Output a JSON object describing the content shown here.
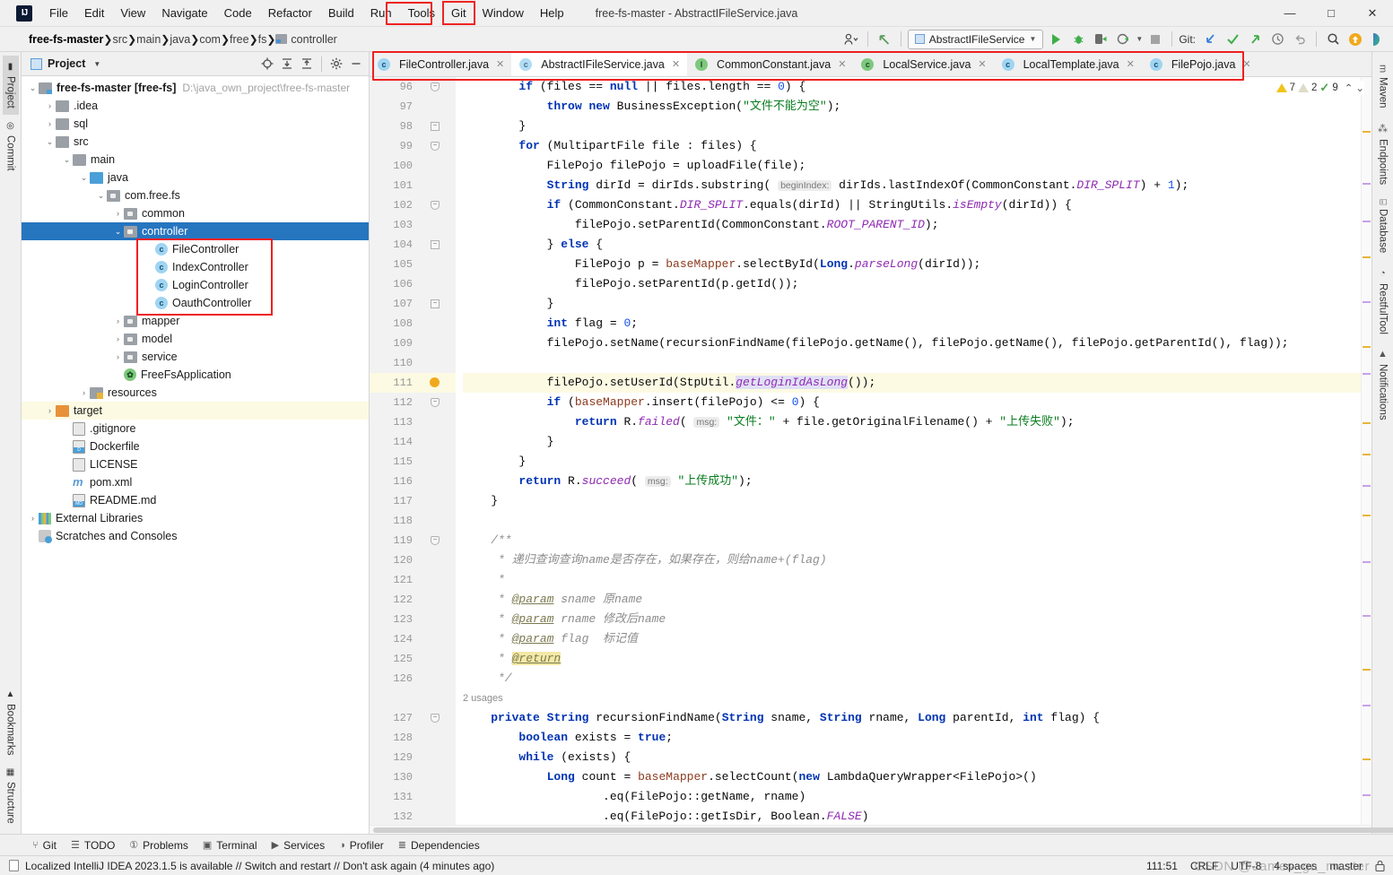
{
  "window": {
    "title": "free-fs-master - AbstractIFileService.java",
    "controls": {
      "minimize": "—",
      "maximize": "□",
      "close": "✕"
    }
  },
  "menubar": {
    "logo": "IJ",
    "items": [
      {
        "label": "File",
        "highlighted": false
      },
      {
        "label": "Edit",
        "highlighted": false
      },
      {
        "label": "View",
        "highlighted": false
      },
      {
        "label": "Navigate",
        "highlighted": false
      },
      {
        "label": "Code",
        "highlighted": false
      },
      {
        "label": "Refactor",
        "highlighted": false
      },
      {
        "label": "Build",
        "highlighted": false
      },
      {
        "label": "Run",
        "highlighted": false
      },
      {
        "label": "Tools",
        "highlighted": false
      },
      {
        "label": "Git",
        "highlighted": true
      },
      {
        "label": "Window",
        "highlighted": false
      },
      {
        "label": "Help",
        "highlighted": false
      }
    ]
  },
  "breadcrumb": {
    "items": [
      "free-fs-master",
      "src",
      "main",
      "java",
      "com",
      "free",
      "fs",
      "controller"
    ]
  },
  "navbar_right": {
    "run_config": "AbstractIFileService",
    "git_label": "Git:",
    "icons": [
      "user-settings-icon",
      "back-arrow-icon",
      "run-icon",
      "debug-icon",
      "run-with-coverage-icon",
      "profile-icon",
      "stop-icon",
      "git-update-icon",
      "git-commit-icon",
      "git-push-icon",
      "git-history-icon",
      "git-rollback-icon",
      "search-everywhere-icon",
      "update-app-icon",
      "ide-assistant-icon"
    ]
  },
  "left_rail": {
    "top": [
      {
        "label": "Project",
        "icon": "project-icon",
        "active": true
      },
      {
        "label": "Commit",
        "icon": "commit-icon",
        "active": false
      }
    ],
    "bottom": [
      {
        "label": "Bookmarks",
        "icon": "bookmark-icon"
      },
      {
        "label": "Structure",
        "icon": "structure-icon"
      }
    ]
  },
  "right_rail": {
    "items": [
      {
        "label": "Maven",
        "icon": "maven-icon"
      },
      {
        "label": "Endpoints",
        "icon": "endpoints-icon"
      },
      {
        "label": "Database",
        "icon": "database-icon"
      },
      {
        "label": "RestfulTool",
        "icon": "restful-tool-icon"
      },
      {
        "label": "Notifications",
        "icon": "notifications-icon"
      }
    ]
  },
  "project_panel": {
    "title": "Project",
    "toolbar_icons": [
      "locate-icon",
      "expand-all-icon",
      "collapse-all-icon",
      "settings-gear-icon",
      "hide-icon"
    ],
    "tree": [
      {
        "indent": 0,
        "arrow": "⌄",
        "icon": "module-folder",
        "label": "free-fs-master [free-fs]",
        "path": "D:\\java_own_project\\free-fs-master",
        "bold_part": "[free-fs]"
      },
      {
        "indent": 1,
        "arrow": "›",
        "icon": "folder-grey",
        "label": ".idea"
      },
      {
        "indent": 1,
        "arrow": "›",
        "icon": "folder-grey",
        "label": "sql"
      },
      {
        "indent": 1,
        "arrow": "⌄",
        "icon": "folder-grey",
        "label": "src"
      },
      {
        "indent": 2,
        "arrow": "⌄",
        "icon": "folder-grey",
        "label": "main"
      },
      {
        "indent": 3,
        "arrow": "⌄",
        "icon": "folder-source",
        "label": "java"
      },
      {
        "indent": 4,
        "arrow": "⌄",
        "icon": "package",
        "label": "com.free.fs"
      },
      {
        "indent": 5,
        "arrow": "›",
        "icon": "package",
        "label": "common"
      },
      {
        "indent": 5,
        "arrow": "⌄",
        "icon": "package",
        "label": "controller",
        "selected": true
      },
      {
        "indent": 6,
        "arrow": "",
        "icon": "java-class",
        "label": "FileController",
        "boxed": true
      },
      {
        "indent": 6,
        "arrow": "",
        "icon": "java-class",
        "label": "IndexController",
        "boxed": true
      },
      {
        "indent": 6,
        "arrow": "",
        "icon": "java-class",
        "label": "LoginController",
        "boxed": true
      },
      {
        "indent": 6,
        "arrow": "",
        "icon": "java-class",
        "label": "OauthController",
        "boxed": true
      },
      {
        "indent": 5,
        "arrow": "›",
        "icon": "package",
        "label": "mapper"
      },
      {
        "indent": 5,
        "arrow": "›",
        "icon": "package",
        "label": "model"
      },
      {
        "indent": 5,
        "arrow": "›",
        "icon": "package",
        "label": "service"
      },
      {
        "indent": 5,
        "arrow": "",
        "icon": "spring-class",
        "label": "FreeFsApplication"
      },
      {
        "indent": 3,
        "arrow": "›",
        "icon": "folder-resources",
        "label": "resources"
      },
      {
        "indent": 1,
        "arrow": "›",
        "icon": "folder-target",
        "label": "target",
        "highlight": true
      },
      {
        "indent": 2,
        "arrow": "",
        "icon": "file-gitignore",
        "label": ".gitignore"
      },
      {
        "indent": 2,
        "arrow": "",
        "icon": "file-docker",
        "label": "Dockerfile"
      },
      {
        "indent": 2,
        "arrow": "",
        "icon": "file-text",
        "label": "LICENSE"
      },
      {
        "indent": 2,
        "arrow": "",
        "icon": "file-maven",
        "label": "pom.xml"
      },
      {
        "indent": 2,
        "arrow": "",
        "icon": "file-markdown",
        "label": "README.md"
      },
      {
        "indent": 0,
        "arrow": "›",
        "icon": "external-libraries",
        "label": "External Libraries"
      },
      {
        "indent": 0,
        "arrow": "",
        "icon": "scratches",
        "label": "Scratches and Consoles"
      }
    ]
  },
  "editor_tabs": [
    {
      "label": "FileController.java",
      "icon": "java-class",
      "active": false
    },
    {
      "label": "AbstractIFileService.java",
      "icon": "java-abstract-class",
      "active": true
    },
    {
      "label": "CommonConstant.java",
      "icon": "java-interface",
      "active": false
    },
    {
      "label": "LocalService.java",
      "icon": "spring-class",
      "active": false
    },
    {
      "label": "LocalTemplate.java",
      "icon": "java-class",
      "active": false
    },
    {
      "label": "FilePojo.java",
      "icon": "java-class",
      "active": false
    }
  ],
  "inspections": {
    "warnings": "7",
    "weak_warnings": "2",
    "checks": "9",
    "up_arrow": "⌃",
    "down_arrow": "⌄"
  },
  "code": {
    "first_line_number": 96,
    "highlighted_line": 111,
    "lines": [
      {
        "n": 96,
        "fold": "end",
        "raw": "        if (files == null || files.length == 0) {"
      },
      {
        "n": 97,
        "fold": "",
        "raw": "            throw new BusinessException(\"文件不能为空\");"
      },
      {
        "n": 98,
        "fold": "plain",
        "raw": "        }"
      },
      {
        "n": 99,
        "fold": "start",
        "raw": "        for (MultipartFile file : files) {"
      },
      {
        "n": 100,
        "fold": "",
        "raw": "            FilePojo filePojo = uploadFile(file);"
      },
      {
        "n": 101,
        "fold": "",
        "raw": "            String dirId = dirIds.substring( beginIndex: dirIds.lastIndexOf(CommonConstant.DIR_SPLIT) + 1);"
      },
      {
        "n": 102,
        "fold": "start",
        "raw": "            if (CommonConstant.DIR_SPLIT.equals(dirId) || StringUtils.isEmpty(dirId)) {"
      },
      {
        "n": 103,
        "fold": "",
        "raw": "                filePojo.setParentId(CommonConstant.ROOT_PARENT_ID);"
      },
      {
        "n": 104,
        "fold": "plain",
        "raw": "            } else {"
      },
      {
        "n": 105,
        "fold": "",
        "raw": "                FilePojo p = baseMapper.selectById(Long.parseLong(dirId));"
      },
      {
        "n": 106,
        "fold": "",
        "raw": "                filePojo.setParentId(p.getId());"
      },
      {
        "n": 107,
        "fold": "plain",
        "raw": "            }"
      },
      {
        "n": 108,
        "fold": "",
        "raw": "            int flag = 0;"
      },
      {
        "n": 109,
        "fold": "",
        "raw": "            filePojo.setName(recursionFindName(filePojo.getName(), filePojo.getName(), filePojo.getParentId(), flag));"
      },
      {
        "n": 110,
        "fold": "",
        "raw": ""
      },
      {
        "n": 111,
        "fold": "bulb",
        "raw": "            filePojo.setUserId(StpUtil.getLoginIdAsLong());"
      },
      {
        "n": 112,
        "fold": "start",
        "raw": "            if (baseMapper.insert(filePojo) <= 0) {"
      },
      {
        "n": 113,
        "fold": "",
        "raw": "                return R.failed( msg: \"文件：\" + file.getOriginalFilename() + \"上传失败\");"
      },
      {
        "n": 114,
        "fold": "",
        "raw": "            }"
      },
      {
        "n": 115,
        "fold": "",
        "raw": "        }"
      },
      {
        "n": 116,
        "fold": "",
        "raw": "        return R.succeed( msg: \"上传成功\");"
      },
      {
        "n": 117,
        "fold": "",
        "raw": "    }"
      },
      {
        "n": 118,
        "fold": "",
        "raw": ""
      },
      {
        "n": 119,
        "fold": "start",
        "raw": "    /**"
      },
      {
        "n": 120,
        "fold": "",
        "raw": "     * 递归查询查询name是否存在，如果存在，则给name+(flag)"
      },
      {
        "n": 121,
        "fold": "",
        "raw": "     *"
      },
      {
        "n": 122,
        "fold": "",
        "raw": "     * @param sname 原name"
      },
      {
        "n": 123,
        "fold": "",
        "raw": "     * @param rname 修改后name"
      },
      {
        "n": 124,
        "fold": "",
        "raw": "     * @param flag  标记值"
      },
      {
        "n": 125,
        "fold": "",
        "raw": "     * @return"
      },
      {
        "n": 126,
        "fold": "",
        "raw": "     */"
      },
      {
        "n": 127,
        "fold": "start",
        "raw": "    private String recursionFindName(String sname, String rname, Long parentId, int flag) {",
        "usages": "2 usages"
      },
      {
        "n": 128,
        "fold": "",
        "raw": "        boolean exists = true;"
      },
      {
        "n": 129,
        "fold": "",
        "raw": "        while (exists) {"
      },
      {
        "n": 130,
        "fold": "",
        "raw": "            Long count = baseMapper.selectCount(new LambdaQueryWrapper<FilePojo>()"
      },
      {
        "n": 131,
        "fold": "",
        "raw": "                    .eq(FilePojo::getName, rname)"
      },
      {
        "n": 132,
        "fold": "",
        "raw": "                    .eq(FilePojo::getIsDir, Boolean.FALSE)"
      }
    ]
  },
  "tool_window_bar": [
    {
      "label": "Git",
      "icon": "git-branch-icon"
    },
    {
      "label": "TODO",
      "icon": "todo-icon"
    },
    {
      "label": "Problems",
      "icon": "problems-icon"
    },
    {
      "label": "Terminal",
      "icon": "terminal-icon"
    },
    {
      "label": "Services",
      "icon": "services-icon"
    },
    {
      "label": "Profiler",
      "icon": "profiler-icon"
    },
    {
      "label": "Dependencies",
      "icon": "dependencies-icon"
    }
  ],
  "status_bar": {
    "message": "Localized IntelliJ IDEA 2023.1.5 is available // Switch and restart // Don't ask again (4 minutes ago)",
    "caret": "111:51",
    "line_separator": "CRLF",
    "encoding": "UTF-8",
    "indent": "4 spaces",
    "branch": "master",
    "watermark": "CSDN @James_ga_master"
  },
  "colors": {
    "accent_blue": "#2675bf",
    "annotation_red": "#ee2020",
    "keyword": "#0033b3",
    "string": "#0a7d20",
    "comment": "#8c8c8c",
    "static_field": "#8f2ab3",
    "highlight_line": "#fdfae3"
  }
}
